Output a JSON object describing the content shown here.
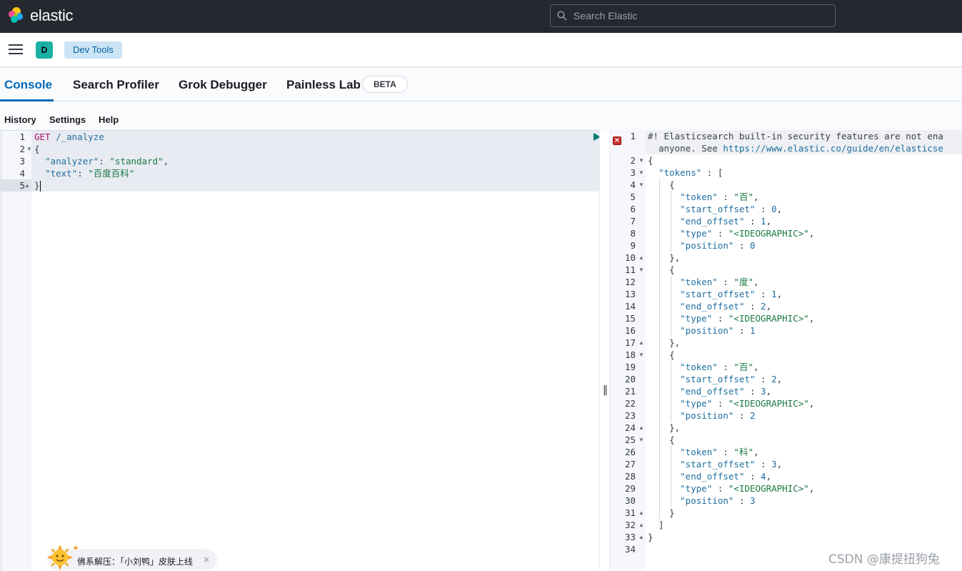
{
  "header": {
    "brand": "elastic",
    "search_placeholder": "Search Elastic"
  },
  "subheader": {
    "space_initial": "D",
    "breadcrumb": "Dev Tools"
  },
  "tabs": [
    {
      "label": "Console",
      "active": true
    },
    {
      "label": "Search Profiler",
      "active": false
    },
    {
      "label": "Grok Debugger",
      "active": false
    },
    {
      "label": "Painless Lab",
      "active": false
    }
  ],
  "beta_badge": "BETA",
  "console_menu": [
    "History",
    "Settings",
    "Help"
  ],
  "request": {
    "method": "GET",
    "path": "/_analyze",
    "analyzer_key": "\"analyzer\"",
    "analyzer_value": "\"standard\"",
    "text_key": "\"text\"",
    "text_value": "\"百度百科\"",
    "open_brace": "{",
    "close_brace": "}",
    "line_numbers": [
      "1",
      "2",
      "3",
      "4",
      "5"
    ]
  },
  "response": {
    "warning_line1": "#! Elasticsearch built-in security features are not ena",
    "warning_line2_prefix": "anyone. See ",
    "warning_link": "https://www.elastic.co/guide/en/elasticse",
    "tokens_key": "\"tokens\"",
    "tokens": [
      {
        "token": "\"百\"",
        "start_offset": "0",
        "end_offset": "1",
        "type": "\"<IDEOGRAPHIC>\"",
        "position": "0"
      },
      {
        "token": "\"度\"",
        "start_offset": "1",
        "end_offset": "2",
        "type": "\"<IDEOGRAPHIC>\"",
        "position": "1"
      },
      {
        "token": "\"百\"",
        "start_offset": "2",
        "end_offset": "3",
        "type": "\"<IDEOGRAPHIC>\"",
        "position": "2"
      },
      {
        "token": "\"科\"",
        "start_offset": "3",
        "end_offset": "4",
        "type": "\"<IDEOGRAPHIC>\"",
        "position": "3"
      }
    ],
    "keys": {
      "token": "\"token\"",
      "start_offset": "\"start_offset\"",
      "end_offset": "\"end_offset\"",
      "type": "\"type\"",
      "position": "\"position\""
    },
    "last_line_number": "34"
  },
  "toast": {
    "text": "佛系解压：「小刘鸭」皮肤上线",
    "close": "×"
  },
  "watermark": "CSDN @康提扭狗兔",
  "divider_grip": "‖",
  "colors": {
    "header_bg": "#25282f",
    "accent": "#006bb8",
    "breadcrumb_bg": "#cce4f5",
    "space_avatar": "#1bb0a4",
    "run_button": "#017d73",
    "error_icon": "#ce2c2c"
  }
}
